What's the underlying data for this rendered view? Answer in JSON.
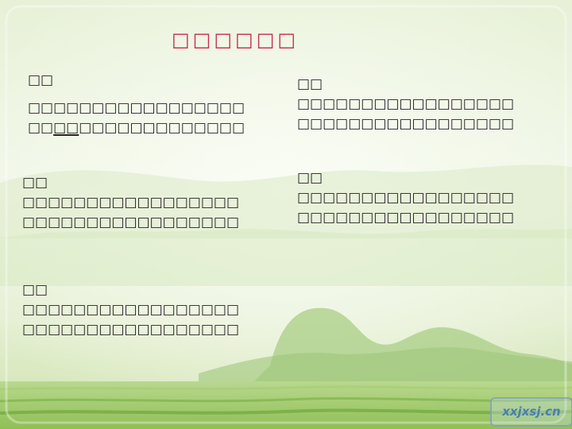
{
  "title": "□□□□□□",
  "blocks": [
    {
      "label": "□□",
      "lines": [
        "□□□□□□□□□□□□□□□□□",
        "□□",
        "□□",
        "□□□□□□□□□□□□□"
      ]
    },
    {
      "label": "□□",
      "lines": [
        "□□□□□□□□□□□□□□□□□",
        "□□□□□□□□□□□□□□□□□"
      ]
    },
    {
      "label": "□□",
      "lines": [
        "□□□□□□□□□□□□□□□□□",
        "□□□□□□□□□□□□□□□□□"
      ]
    },
    {
      "label": "□□",
      "lines": [
        "□□□□□□□□□□□□□□□□□",
        "□□□□□□□□□□□□□□□□□"
      ]
    },
    {
      "label": "□□",
      "lines": [
        "□□□□□□□□□□□□□□□□□",
        "□□□□□□□□□□□□□□□□□"
      ]
    }
  ],
  "watermark": "xxjxsj.cn",
  "colors": {
    "title": "#c8294a",
    "background": "#e8f3d8"
  }
}
